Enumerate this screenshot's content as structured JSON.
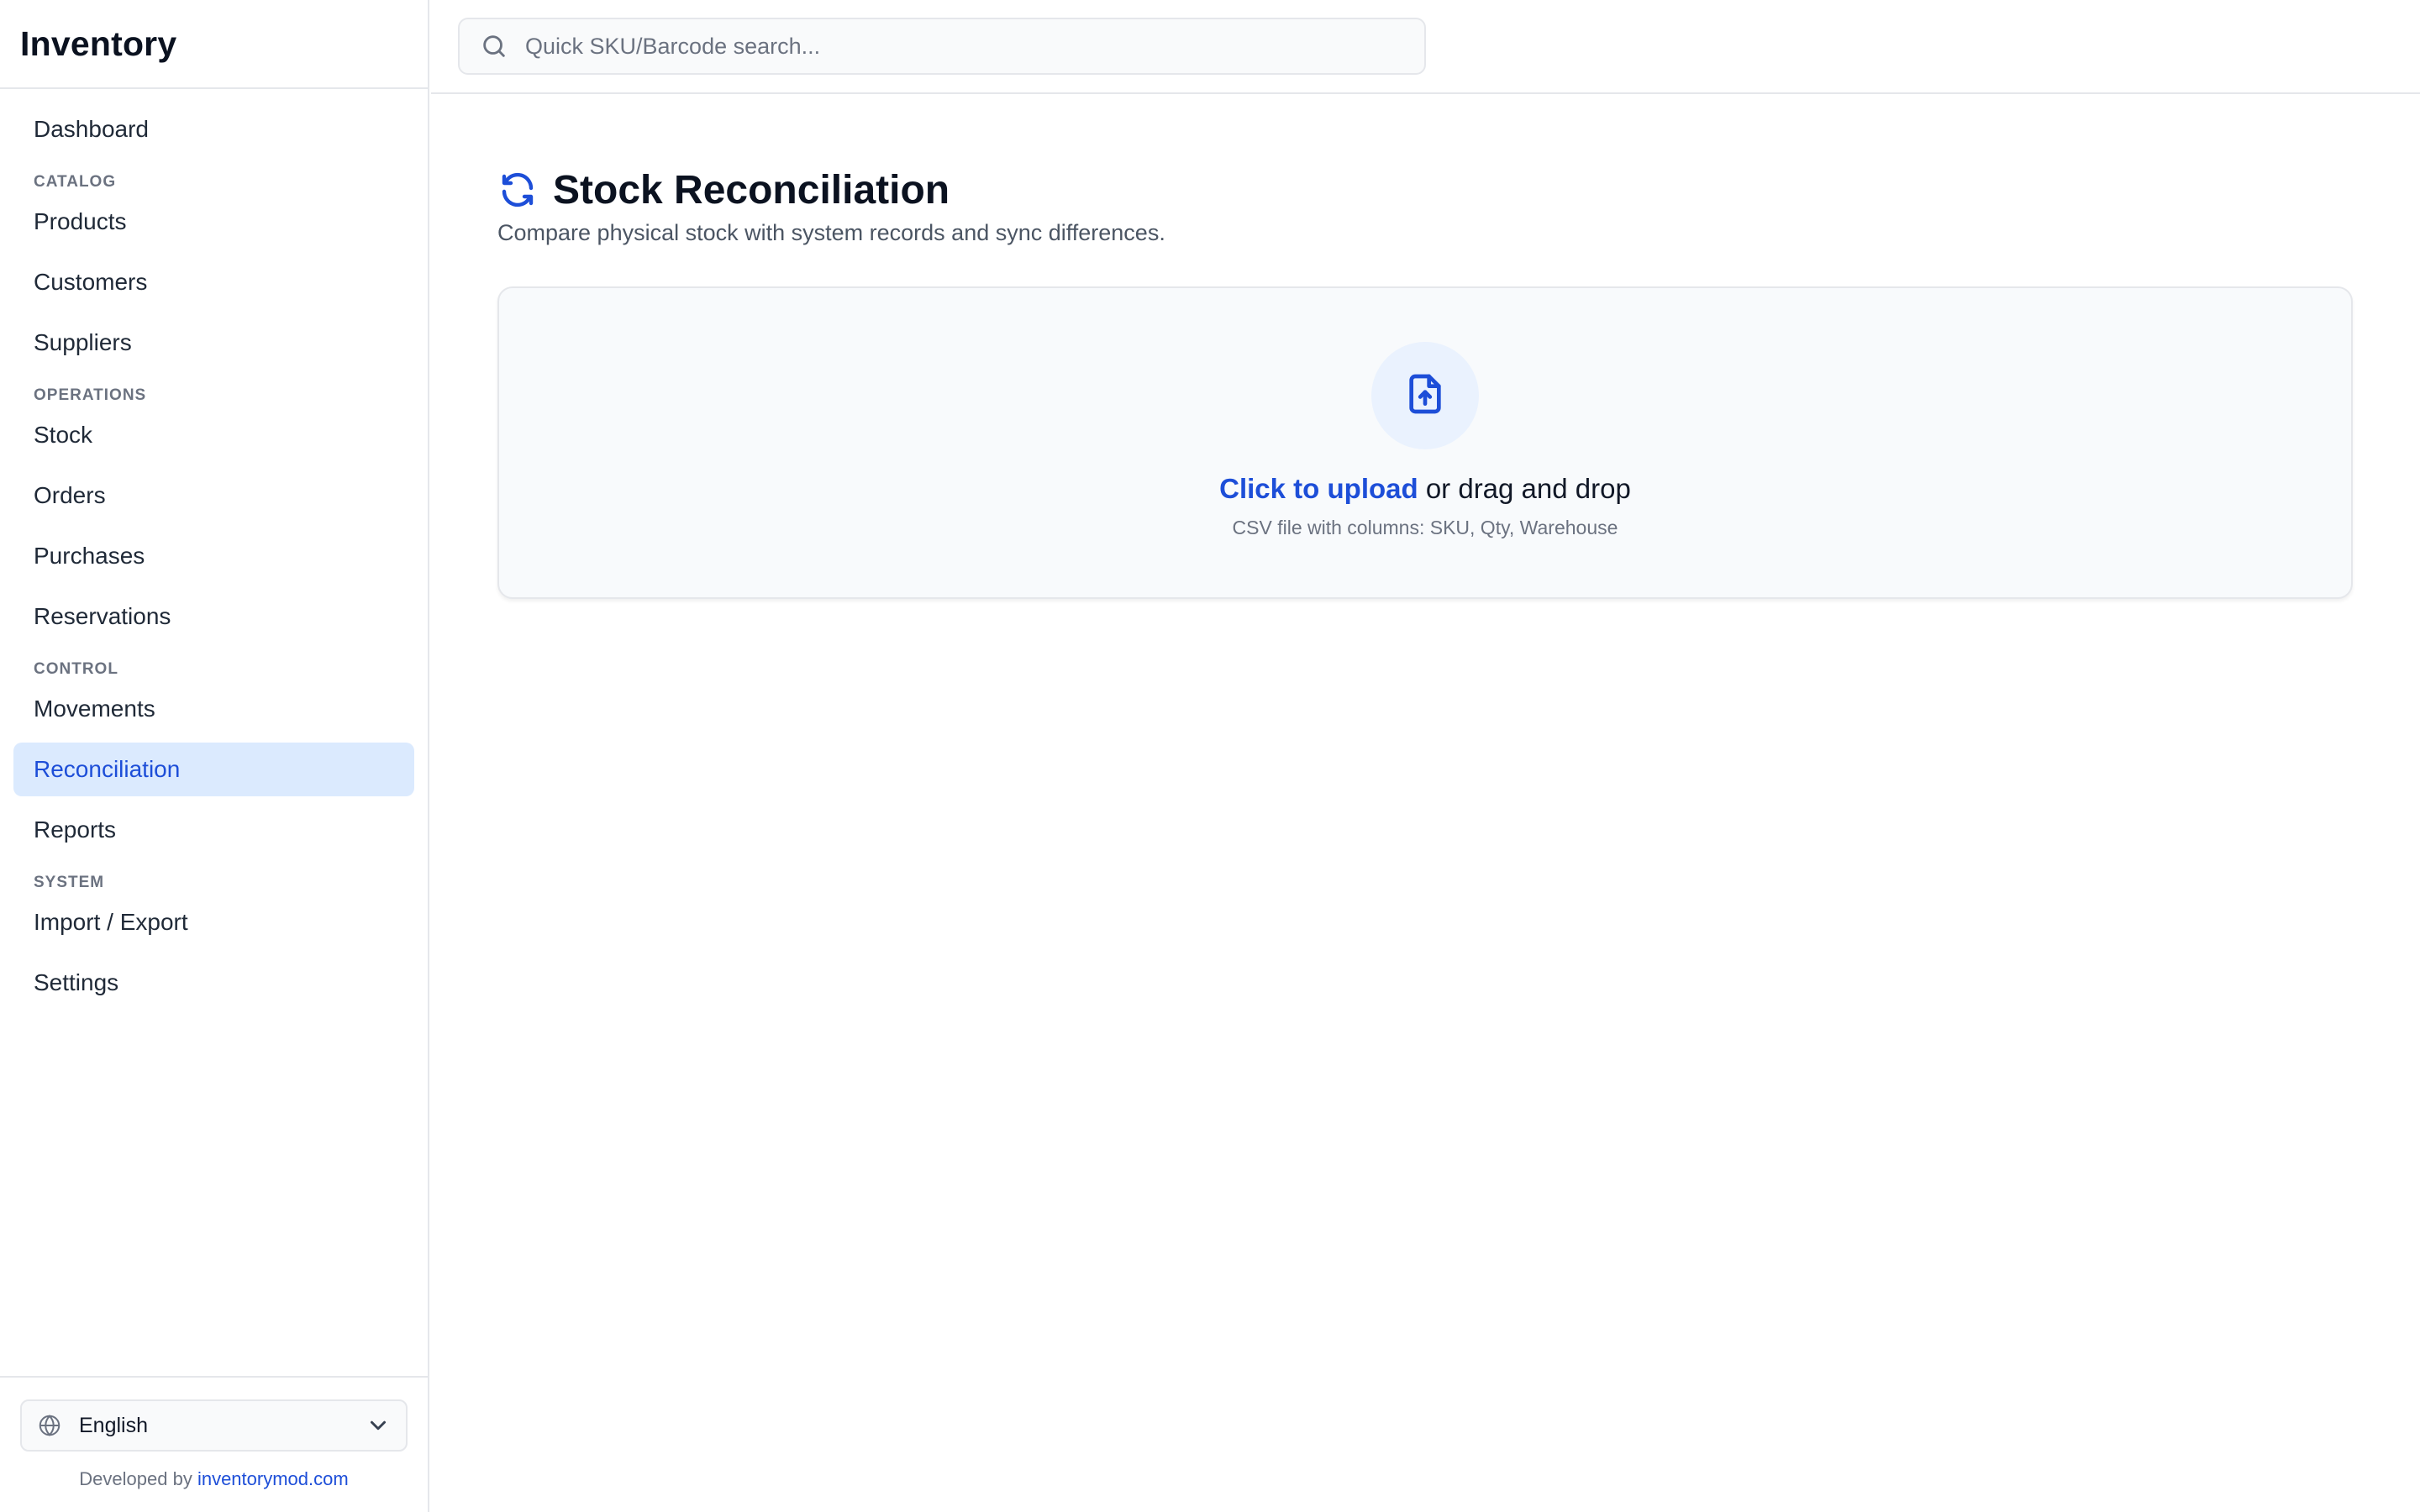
{
  "brand": {
    "title": "Inventory"
  },
  "sidebar": {
    "items": [
      {
        "type": "item",
        "label": "Dashboard",
        "name": "sidebar-item-dashboard"
      },
      {
        "type": "section",
        "label": "CATALOG",
        "name": "section-catalog"
      },
      {
        "type": "item",
        "label": "Products",
        "name": "sidebar-item-products"
      },
      {
        "type": "item",
        "label": "Customers",
        "name": "sidebar-item-customers"
      },
      {
        "type": "item",
        "label": "Suppliers",
        "name": "sidebar-item-suppliers"
      },
      {
        "type": "section",
        "label": "OPERATIONS",
        "name": "section-operations"
      },
      {
        "type": "item",
        "label": "Stock",
        "name": "sidebar-item-stock"
      },
      {
        "type": "item",
        "label": "Orders",
        "name": "sidebar-item-orders"
      },
      {
        "type": "item",
        "label": "Purchases",
        "name": "sidebar-item-purchases"
      },
      {
        "type": "item",
        "label": "Reservations",
        "name": "sidebar-item-reservations"
      },
      {
        "type": "section",
        "label": "CONTROL",
        "name": "section-control"
      },
      {
        "type": "item",
        "label": "Movements",
        "name": "sidebar-item-movements"
      },
      {
        "type": "item",
        "label": "Reconciliation",
        "name": "sidebar-item-reconciliation",
        "active": true
      },
      {
        "type": "item",
        "label": "Reports",
        "name": "sidebar-item-reports"
      },
      {
        "type": "section",
        "label": "SYSTEM",
        "name": "section-system"
      },
      {
        "type": "item",
        "label": "Import / Export",
        "name": "sidebar-item-import-export"
      },
      {
        "type": "item",
        "label": "Settings",
        "name": "sidebar-item-settings"
      }
    ],
    "language": {
      "selected": "English",
      "icon": "globe-icon"
    },
    "credit": {
      "prefix": "Developed by",
      "link": "inventorymod.com"
    }
  },
  "header": {
    "search": {
      "placeholder": "Quick SKU/Barcode search...",
      "value": "",
      "icon": "search-icon"
    }
  },
  "page": {
    "title": "Stock Reconciliation",
    "title_icon": "refresh-icon",
    "subtitle": "Compare physical stock with system records and sync differences.",
    "upload": {
      "icon": "file-upload-icon",
      "link_text": "Click to upload",
      "rest_text": "or drag and drop",
      "hint": "CSV file with columns: SKU, Qty, Warehouse"
    }
  },
  "colors": {
    "accent": "#1d4ed8",
    "active_bg": "#dbeafe",
    "border": "#e5e7eb",
    "muted_text": "#6b7280"
  }
}
